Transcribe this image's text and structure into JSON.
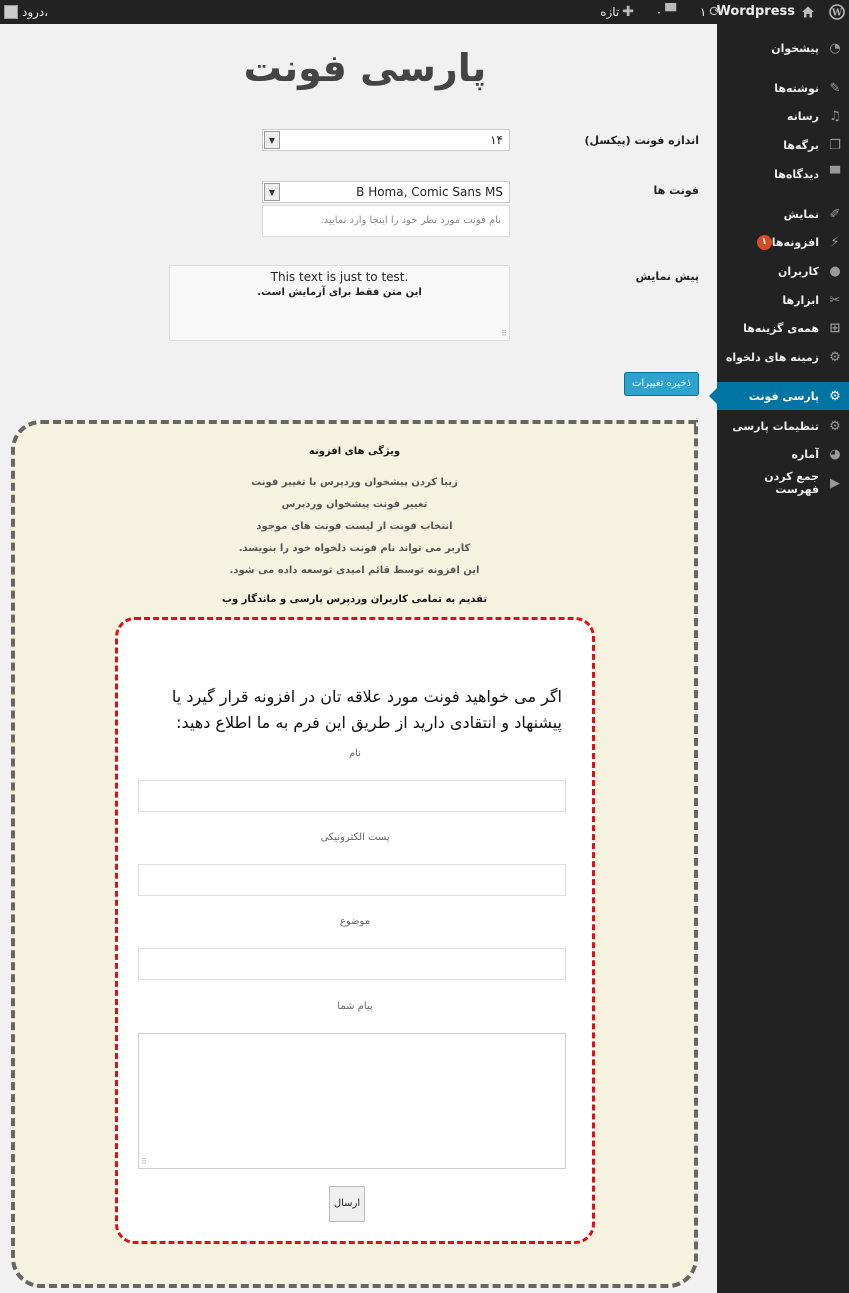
{
  "adminbar": {
    "site_name": "Wordpress",
    "updates_count": "۱",
    "comments_count": "۰",
    "new_label": "تازه",
    "greeting": "درود،"
  },
  "sidebar": {
    "items": [
      {
        "label": "پیشخوان",
        "icon": "dashboard-icon"
      },
      {
        "label": "نوشته‌ها",
        "icon": "pin-icon"
      },
      {
        "label": "رسانه",
        "icon": "media-icon"
      },
      {
        "label": "برگه‌ها",
        "icon": "pages-icon"
      },
      {
        "label": "دیدگاه‌ها",
        "icon": "comments-icon"
      },
      {
        "label": "نمایش",
        "icon": "appearance-icon"
      },
      {
        "label": "افزونه‌ها",
        "icon": "plugins-icon",
        "badge": "۱"
      },
      {
        "label": "کاربران",
        "icon": "users-icon"
      },
      {
        "label": "ابزارها",
        "icon": "tools-icon"
      },
      {
        "label": "همه‌ی گزینه‌ها",
        "icon": "all-options-icon"
      },
      {
        "label": "زمینه های دلخواه",
        "icon": "gear-icon"
      },
      {
        "label": "پارسی فونت",
        "icon": "gear-icon",
        "active": true
      },
      {
        "label": "تنظیمات پارسی",
        "icon": "gear-icon"
      },
      {
        "label": "آماره",
        "icon": "stats-icon"
      },
      {
        "label": "جمع کردن فهرست",
        "icon": "collapse-icon"
      }
    ]
  },
  "main": {
    "title": "پارسی فونت",
    "font_size_label": "اندازه فونت (پیکسل)",
    "font_size_value": "۱۴",
    "fonts_label": "فونت ها",
    "fonts_value": "B Homa, Comic Sans MS",
    "fonts_placeholder": "نام فونت مورد نظر خود را اینجا وارد نمایید.",
    "preview_label": "پیش نمایش",
    "preview_line1": "This text is just to test.",
    "preview_line2": "این متن فقط برای آزمایش است.",
    "save_label": "ذخیره تغییرات"
  },
  "features": {
    "title": "ویژگی های افزونه",
    "items": [
      "زیبا کردن پیشخوان وردپرس با تغییر فونت",
      "تغییر فونت پیشخوان وردپرس",
      "انتخاب فونت از لیست فونت های موجود",
      "کاربر می تواند نام فونت دلخواه خود را بنویسد.",
      "این افزونه توسط قائم امیدی توسعه داده می شود."
    ],
    "dedication": "تقدیم به تمامی کاربران وردپرس پارسی و ماندگار وب"
  },
  "contact": {
    "intro": "اگر می خواهید فونت مورد علاقه تان در افزونه قرار گیرد یا پیشنهاد و انتقادی دارید از طریق این فرم به ما اطلاع دهید:",
    "name_label": "نام",
    "email_label": "پست الکترونیکی",
    "subject_label": "موضوع",
    "message_label": "پیام شما",
    "send_label": "ارسال"
  },
  "colors": {
    "sidebar_bg": "#222222",
    "active_menu": "#0074a2",
    "save_button": "#2ea2cc",
    "features_bg": "#f5f3e0",
    "contact_border": "#e01010"
  }
}
